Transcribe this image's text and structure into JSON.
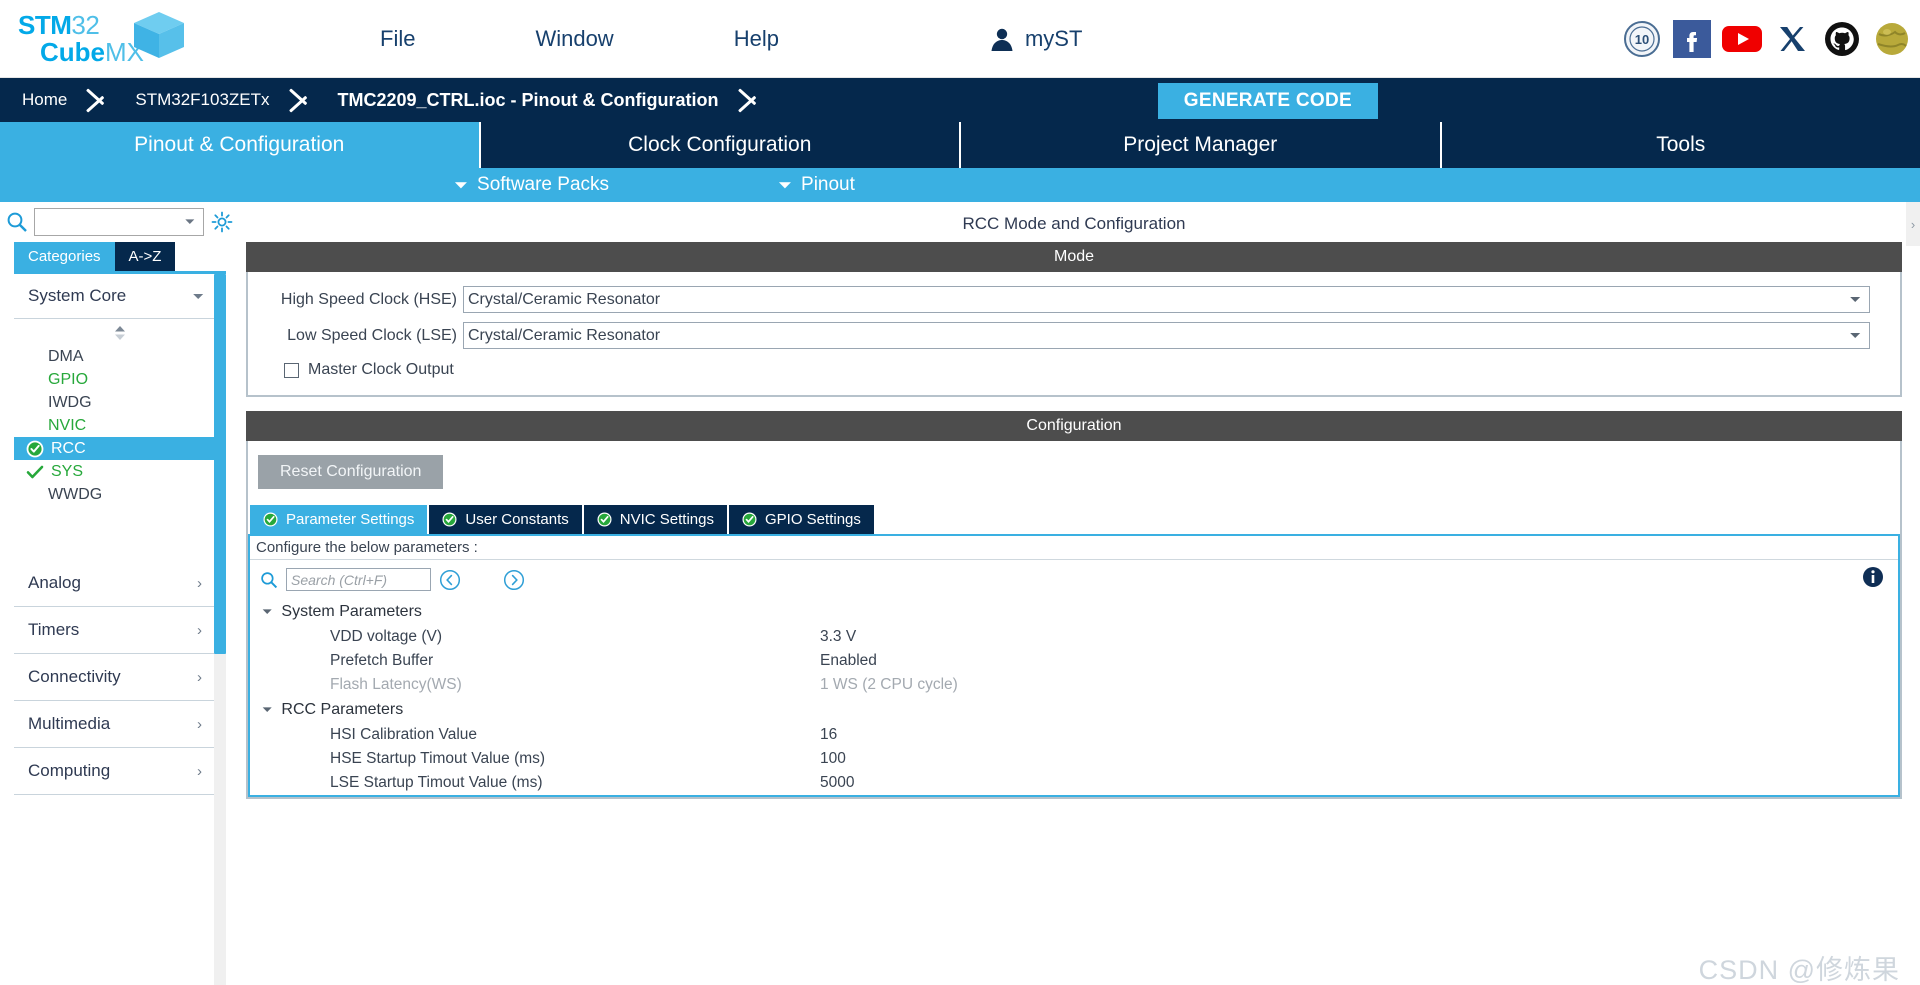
{
  "app": {
    "logo_line1": "STM32",
    "logo_line1_thin": "32",
    "logo_top": "STM",
    "logo_bottom": "Cube",
    "logo_bottom_thin": "MX"
  },
  "menu": {
    "items": [
      {
        "label": "File",
        "name": "menu-file"
      },
      {
        "label": "Window",
        "name": "menu-window"
      },
      {
        "label": "Help",
        "name": "menu-help"
      }
    ],
    "account_label": "myST",
    "socials": [
      {
        "name": "ten-years-badge-icon",
        "label": "10"
      },
      {
        "name": "facebook-icon",
        "label": "f"
      },
      {
        "name": "youtube-icon",
        "label": "▶"
      },
      {
        "name": "x-twitter-icon",
        "label": "X"
      },
      {
        "name": "github-icon",
        "label": "GitHub"
      },
      {
        "name": "wiki-globe-icon",
        "label": "Wiki"
      }
    ]
  },
  "breadcrumb": {
    "home": "Home",
    "device": "STM32F103ZETx",
    "project": "TMC2209_CTRL.ioc - Pinout & Configuration",
    "generate_code": "GENERATE CODE"
  },
  "main_tabs": [
    {
      "label": "Pinout & Configuration",
      "selected": true
    },
    {
      "label": "Clock Configuration",
      "selected": false
    },
    {
      "label": "Project Manager",
      "selected": false
    },
    {
      "label": "Tools",
      "selected": false
    }
  ],
  "sub_bar": {
    "software_packs": "Software Packs",
    "pinout": "Pinout"
  },
  "sidebar": {
    "search_value": "",
    "category_tabs": [
      {
        "label": "Categories",
        "selected": true
      },
      {
        "label": "A->Z",
        "selected": false
      }
    ],
    "group": {
      "label": "System Core",
      "expanded": true
    },
    "peripherals": [
      {
        "label": "DMA",
        "state": "none",
        "selected": false
      },
      {
        "label": "GPIO",
        "state": "green",
        "selected": false
      },
      {
        "label": "IWDG",
        "state": "none",
        "selected": false
      },
      {
        "label": "NVIC",
        "state": "green",
        "selected": false
      },
      {
        "label": "RCC",
        "state": "checked",
        "selected": true
      },
      {
        "label": "SYS",
        "state": "checkmark",
        "selected": false
      },
      {
        "label": "WWDG",
        "state": "none",
        "selected": false
      }
    ],
    "categories": [
      {
        "label": "Analog"
      },
      {
        "label": "Timers"
      },
      {
        "label": "Connectivity"
      },
      {
        "label": "Multimedia"
      },
      {
        "label": "Computing"
      }
    ]
  },
  "panel": {
    "title": "RCC Mode and Configuration",
    "mode_header": "Mode",
    "configuration_header": "Configuration",
    "mode": {
      "rows": [
        {
          "label": "High Speed Clock (HSE)",
          "value": "Crystal/Ceramic Resonator"
        },
        {
          "label": "Low Speed Clock (LSE)",
          "value": "Crystal/Ceramic Resonator"
        }
      ],
      "checkbox_label": "Master Clock Output",
      "checkbox_checked": false
    },
    "configuration": {
      "reset_button": "Reset Configuration",
      "tabs": [
        {
          "label": "Parameter Settings",
          "selected": true
        },
        {
          "label": "User Constants",
          "selected": false
        },
        {
          "label": "NVIC Settings",
          "selected": false
        },
        {
          "label": "GPIO Settings",
          "selected": false
        }
      ],
      "hint": "Configure the below parameters :",
      "search_placeholder": "Search (Ctrl+F)",
      "search_value": "",
      "groups": [
        {
          "label": "System Parameters",
          "expanded": true,
          "rows": [
            {
              "name": "VDD voltage (V)",
              "value": "3.3 V",
              "dim": false
            },
            {
              "name": "Prefetch Buffer",
              "value": "Enabled",
              "dim": false
            },
            {
              "name": "Flash Latency(WS)",
              "value": "1 WS (2 CPU cycle)",
              "dim": true
            }
          ]
        },
        {
          "label": "RCC Parameters",
          "expanded": true,
          "rows": [
            {
              "name": "HSI Calibration Value",
              "value": "16",
              "dim": false
            },
            {
              "name": "HSE Startup Timout Value (ms)",
              "value": "100",
              "dim": false
            },
            {
              "name": "LSE Startup Timout Value (ms)",
              "value": "5000",
              "dim": false
            }
          ]
        }
      ]
    }
  },
  "watermark": "CSDN @修炼果",
  "colors": {
    "accent": "#3ab0e2",
    "navy": "#05284c",
    "dark_bar": "#4d4d4d",
    "green": "#27a83b"
  }
}
